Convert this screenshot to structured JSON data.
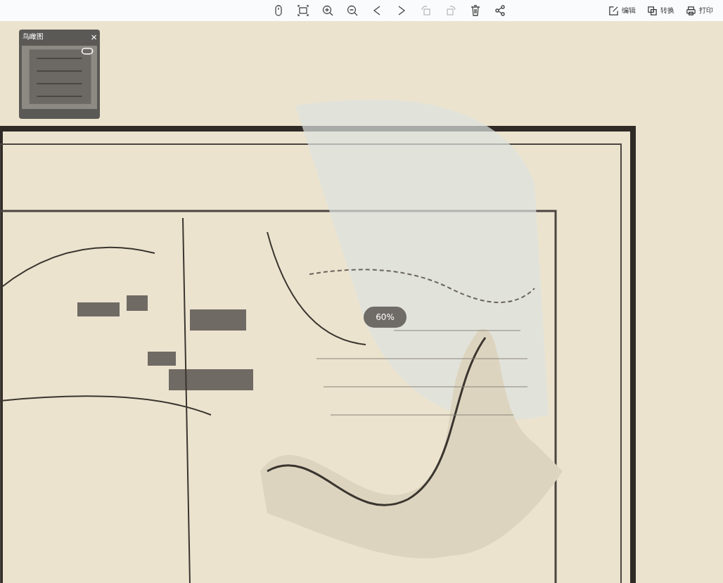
{
  "toolbar": {
    "tools": [
      {
        "kind": "mouse",
        "disabled": false
      },
      {
        "kind": "fit",
        "disabled": false
      },
      {
        "kind": "zoom-in",
        "disabled": false
      },
      {
        "kind": "zoom-out",
        "disabled": false
      },
      {
        "kind": "prev",
        "disabled": false
      },
      {
        "kind": "next",
        "disabled": false
      },
      {
        "kind": "rotate-left",
        "disabled": true
      },
      {
        "kind": "rotate-right",
        "disabled": true
      },
      {
        "kind": "delete",
        "disabled": false
      },
      {
        "kind": "share",
        "disabled": false
      }
    ],
    "actions": [
      {
        "kind": "edit",
        "label": "编辑"
      },
      {
        "kind": "convert",
        "label": "转换"
      },
      {
        "kind": "print",
        "label": "打印"
      }
    ]
  },
  "viewer": {
    "zoom_badge": "60%"
  },
  "overview": {
    "title": "鸟瞰图",
    "close": "×"
  }
}
